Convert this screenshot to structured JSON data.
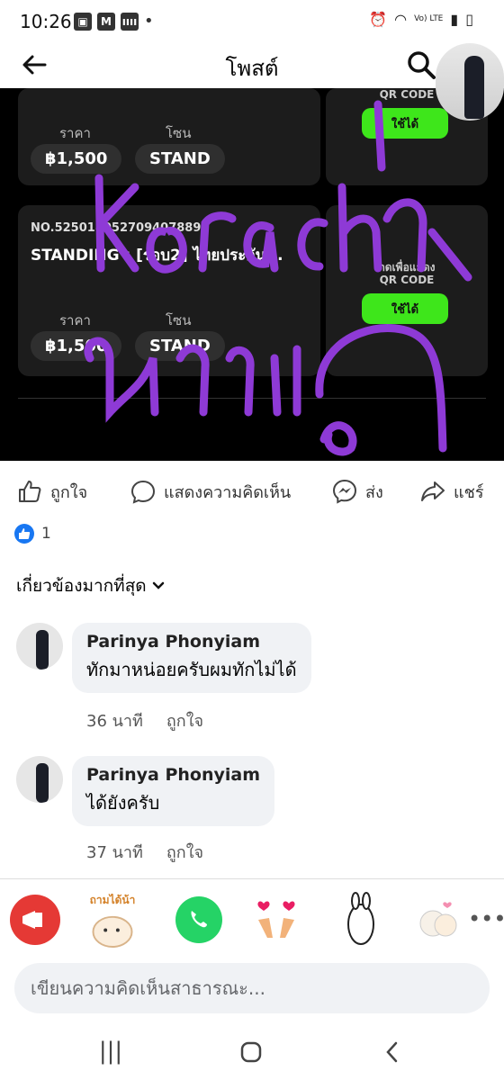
{
  "status_bar": {
    "time": "10:26",
    "m_badge": "M",
    "volte": "Vo) LTE"
  },
  "header": {
    "title": "โพสต์"
  },
  "tickets": [
    {
      "no": "",
      "name": "",
      "price_label": "ราคา",
      "price": "฿1,500",
      "zone_label": "โซน",
      "zone": "STAND",
      "qr_caption": "QR CODE",
      "use_label": "ใช้ได้"
    },
    {
      "no": "NO.525018052709407889",
      "name": "STANDING : [รอบ2] ไทยประกัน...",
      "price_label": "ราคา",
      "price": "฿1,500",
      "zone_label": "โซน",
      "zone": "STAND",
      "qr_top": "กดเพื่อแสดง",
      "qr_caption": "QR CODE",
      "use_label": "ใช้ได้"
    }
  ],
  "scribble_text": {
    "line1": "1",
    "line2": "korach",
    "line3": "หาเลิก"
  },
  "actions": {
    "like": "ถูกใจ",
    "comment": "แสดงความคิดเห็น",
    "send": "ส่ง",
    "share": "แชร์"
  },
  "reactions": {
    "count": "1"
  },
  "sort_label": "เกี่ยวข้องมากที่สุด",
  "comments": [
    {
      "name": "Parinya Phonyiam",
      "text": "ทักมาหน่อยครับผมทักไม่ได้",
      "time": "36 นาที",
      "like": "ถูกใจ"
    },
    {
      "name": "Parinya Phonyiam",
      "text": "ได้ยังครับ",
      "time": "37 นาที",
      "like": "ถูกใจ"
    }
  ],
  "stickers": {
    "sticker2_text": "ถามได้น้า",
    "more": "•••"
  },
  "composer": {
    "placeholder": "เขียนความคิดเห็นสาธารณะ..."
  },
  "nav": {
    "recent": "|||",
    "back": "‹"
  },
  "colors": {
    "accent": "#1877f2",
    "ticket_green": "#3ee61b",
    "scribble": "#8e3ad6"
  }
}
